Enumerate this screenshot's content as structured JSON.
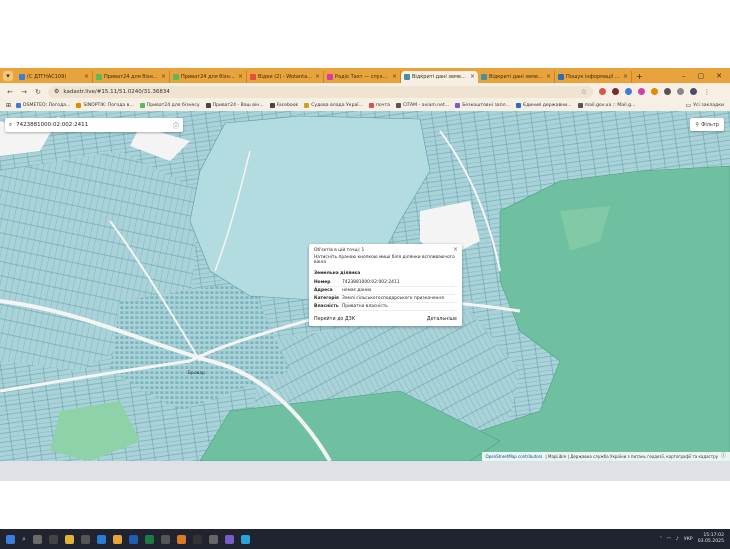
{
  "browser": {
    "tabs": [
      {
        "title": "(С ДТГНАС109)",
        "favicon": "#3b7dd8",
        "active": false
      },
      {
        "title": "Приват24 для бізнесу",
        "favicon": "#5cb85c",
        "active": false
      },
      {
        "title": "Приват24 для бізнесу",
        "favicon": "#5cb85c",
        "active": false
      },
      {
        "title": "Відеи (2) - Wotantaxi(1)",
        "favicon": "#e94b3c",
        "active": false
      },
      {
        "title": "Радіо Тахт — слухати",
        "favicon": "#d63ea7",
        "active": false
      },
      {
        "title": "Відкриті дані земельно",
        "favicon": "#4a8f9d",
        "active": true
      },
      {
        "title": "Відкриті дані земельно",
        "favicon": "#4a8f9d",
        "active": false
      },
      {
        "title": "Пошук інформації - E.u",
        "favicon": "#2a6ebb",
        "active": false
      }
    ],
    "new_tab": "+",
    "url": "kadastr.live/#15.11/51.0240/31.36834",
    "bookmarks": [
      {
        "label": "DSMETEO: Погода...",
        "color": "#3b7dd8"
      },
      {
        "label": "SINOPTIK: Погода в...",
        "color": "#e28b00"
      },
      {
        "label": "Приват24 для бізнесу",
        "color": "#5cb85c"
      },
      {
        "label": "Приват24 - Ваш він...",
        "color": "#444444"
      },
      {
        "label": "Facebook",
        "color": "#444444"
      },
      {
        "label": "Судова влада Украї...",
        "color": "#c9a227"
      },
      {
        "label": "почта",
        "color": "#d9534f"
      },
      {
        "label": "CITAM - aviam.net...",
        "color": "#555555"
      },
      {
        "label": "Безкоштовні запл...",
        "color": "#7a5cc6"
      },
      {
        "label": "Єдиний державни...",
        "color": "#2a6ebb"
      },
      {
        "label": "mail.gov.ua :: Mail.g...",
        "color": "#555555"
      }
    ],
    "all_bookmarks": "Усі закладки"
  },
  "map": {
    "search": {
      "value": "7423881000:02:002:2411"
    },
    "filter_label": "Фільтр",
    "village_label": "Бровар",
    "popup": {
      "objects_count": "Об'єктів в цій точці: 1",
      "hint": "Натисніть праною кнопкою миші біля ділянки вспливаючого вікна",
      "section_title": "Земельна ділянка",
      "rows": [
        {
          "key": "Номер",
          "value": "7423881000:02:002:2411"
        },
        {
          "key": "Адреса",
          "value": "немає даних"
        },
        {
          "key": "Категорія",
          "value": "Землі сільськогосподарського призначення"
        },
        {
          "key": "Власність",
          "value": "Приватна власність"
        }
      ],
      "action_go": "Перейти до ДЗК",
      "action_details": "Детальніше"
    },
    "attribution": {
      "osm": "OpenStreetMap contributors",
      "rest": "| MapLibre | Державна служба України з питань геодезії, картографії та кадастру"
    },
    "colors": {
      "parcel": "#a9d3d9",
      "parcel_stroke": "#5d9aa3",
      "forest": "#6fc0a0",
      "lake": "#a9d3d9",
      "road": "#f4f4f4",
      "meadow": "#8fd1a8"
    }
  },
  "taskbar": {
    "language": "УКР",
    "time": "15:17:02",
    "date": "03.05.2025"
  }
}
